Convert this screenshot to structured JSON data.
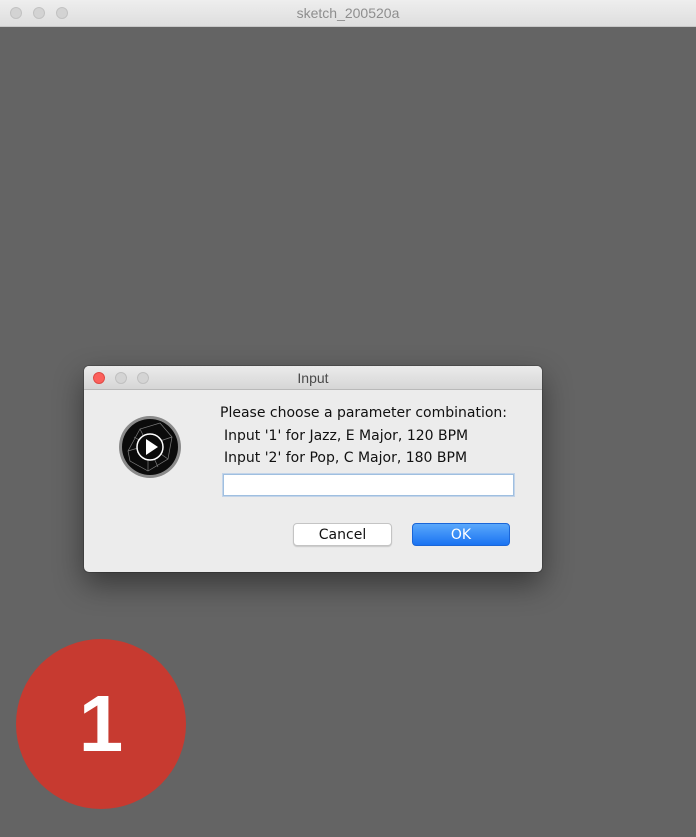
{
  "window": {
    "title": "sketch_200520a"
  },
  "canvas": {
    "background": "#646464",
    "badge": {
      "label": "1",
      "color": "#c73a30"
    }
  },
  "dialog": {
    "title": "Input",
    "icon": "java-play-icon",
    "message_lines": [
      "Please choose a parameter combination:",
      "Input '1' for Jazz, E Major, 120 BPM",
      "Input '2' for Pop, C Major, 180 BPM"
    ],
    "input": {
      "value": "",
      "placeholder": ""
    },
    "buttons": {
      "cancel": "Cancel",
      "ok": "OK"
    },
    "accent": "#1a73f2"
  }
}
